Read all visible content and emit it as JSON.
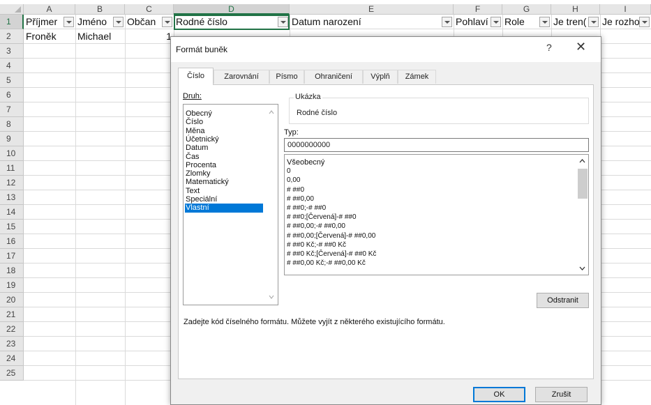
{
  "sheet": {
    "columns": [
      {
        "label": "A"
      },
      {
        "label": "B"
      },
      {
        "label": "C"
      },
      {
        "label": "D"
      },
      {
        "label": "E"
      },
      {
        "label": "F"
      },
      {
        "label": "G"
      },
      {
        "label": "H"
      },
      {
        "label": "I"
      }
    ],
    "rows": [
      "1",
      "2",
      "3",
      "4",
      "5",
      "6",
      "7",
      "8",
      "9",
      "10",
      "11",
      "12",
      "13",
      "14",
      "15",
      "16",
      "17",
      "18",
      "19",
      "20",
      "21",
      "22",
      "23",
      "24",
      "25"
    ],
    "row1": [
      "Příjmer",
      "Jméno",
      "Občan",
      "Rodné číslo",
      "Datum narození",
      "Pohlaví",
      "Role",
      "Je tren(",
      "Je rozhoc"
    ],
    "row2": {
      "a": "Froněk",
      "b": "Michael",
      "c": "1"
    }
  },
  "dialog": {
    "title": "Formát buněk",
    "help": "?",
    "close": "✕",
    "tabs": [
      "Číslo",
      "Zarovnání",
      "Písmo",
      "Ohraničení",
      "Výplň",
      "Zámek"
    ],
    "druh_label": "Druh:",
    "categories": [
      "Obecný",
      "Číslo",
      "Měna",
      "Účetnický",
      "Datum",
      "Čas",
      "Procenta",
      "Zlomky",
      "Matematický",
      "Text",
      "Speciální",
      "Vlastní"
    ],
    "selected_category": "Vlastní",
    "sample_label": "Ukázka",
    "sample_value": "Rodné číslo",
    "type_label": "Typ:",
    "type_value": "0000000000",
    "format_codes": [
      "Všeobecný",
      "0",
      "0,00",
      "# ##0",
      "# ##0,00",
      "# ##0;-# ##0",
      "# ##0;[Červená]-# ##0",
      "# ##0,00;-# ##0,00",
      "# ##0,00;[Červená]-# ##0,00",
      "# ##0 Kč;-# ##0 Kč",
      "# ##0 Kč;[Červená]-# ##0 Kč",
      "# ##0,00 Kč;-# ##0,00 Kč"
    ],
    "delete_button": "Odstranit",
    "description": "Zadejte kód číselného formátu. Můžete vyjít z některého existujícího formátu.",
    "ok_button": "OK",
    "cancel_button": "Zrušit"
  },
  "colors": {
    "excel_green": "#217346",
    "selection_blue": "#0078d7"
  }
}
